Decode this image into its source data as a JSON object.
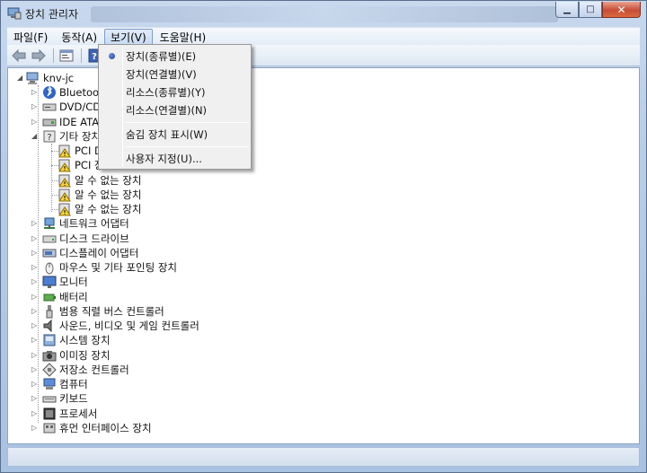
{
  "window": {
    "title": "장치 관리자",
    "controls": {
      "minimize": "▁",
      "maximize": "□",
      "close": "✕"
    }
  },
  "menubar": {
    "items": [
      {
        "label": "파일(F)",
        "active": false
      },
      {
        "label": "동작(A)",
        "active": false
      },
      {
        "label": "보기(V)",
        "active": true
      },
      {
        "label": "도움말(H)",
        "active": false
      }
    ]
  },
  "toolbar": {
    "buttons": [
      "back-arrow-icon",
      "forward-arrow-icon",
      "properties-icon",
      "help-icon"
    ]
  },
  "view_menu": {
    "items": [
      {
        "label": "장치(종류별)(E)",
        "checked": true
      },
      {
        "label": "장치(연결별)(V)",
        "checked": false
      },
      {
        "label": "리소스(종류별)(Y)",
        "checked": false
      },
      {
        "label": "리소스(연결별)(N)",
        "checked": false
      },
      {
        "label": "숨김 장치 표시(W)",
        "checked": false
      },
      {
        "label": "사용자 지정(U)...",
        "checked": false
      }
    ]
  },
  "tree": {
    "root": "knv-jc",
    "nodes": [
      {
        "label": "Bluetooth",
        "icon": "bluetooth-icon",
        "level": 1,
        "expander": "collapsed"
      },
      {
        "label": "DVD/CD",
        "icon": "dvd-drive-icon",
        "level": 1,
        "expander": "collapsed"
      },
      {
        "label": "IDE ATA/",
        "icon": "ide-controller-icon",
        "level": 1,
        "expander": "collapsed"
      },
      {
        "label": "기타 장치",
        "icon": "unknown-device-icon",
        "level": 1,
        "expander": "expanded"
      },
      {
        "label": "PCI D",
        "icon": "warning-device-icon",
        "level": 2
      },
      {
        "label": "PCI 장",
        "icon": "warning-device-icon",
        "level": 2
      },
      {
        "label": "알 수 없는 장치",
        "icon": "warning-device-icon",
        "level": 2
      },
      {
        "label": "알 수 없는 장치",
        "icon": "warning-device-icon",
        "level": 2
      },
      {
        "label": "알 수 없는 장치",
        "icon": "warning-device-icon",
        "level": 2
      },
      {
        "label": "네트워크 어댑터",
        "icon": "network-adapter-icon",
        "level": 1,
        "expander": "collapsed"
      },
      {
        "label": "디스크 드라이브",
        "icon": "disk-drive-icon",
        "level": 1,
        "expander": "collapsed"
      },
      {
        "label": "디스플레이 어댑터",
        "icon": "display-adapter-icon",
        "level": 1,
        "expander": "collapsed"
      },
      {
        "label": "마우스 및 기타 포인팅 장치",
        "icon": "mouse-icon",
        "level": 1,
        "expander": "collapsed"
      },
      {
        "label": "모니터",
        "icon": "monitor-icon",
        "level": 1,
        "expander": "collapsed"
      },
      {
        "label": "배터리",
        "icon": "battery-icon",
        "level": 1,
        "expander": "collapsed"
      },
      {
        "label": "범용 직렬 버스 컨트롤러",
        "icon": "usb-icon",
        "level": 1,
        "expander": "collapsed"
      },
      {
        "label": "사운드, 비디오 및 게임 컨트롤러",
        "icon": "speaker-icon",
        "level": 1,
        "expander": "collapsed"
      },
      {
        "label": "시스템 장치",
        "icon": "system-device-icon",
        "level": 1,
        "expander": "collapsed"
      },
      {
        "label": "이미징 장치",
        "icon": "imaging-device-icon",
        "level": 1,
        "expander": "collapsed"
      },
      {
        "label": "저장소 컨트롤러",
        "icon": "storage-controller-icon",
        "level": 1,
        "expander": "collapsed"
      },
      {
        "label": "컴퓨터",
        "icon": "computer-icon",
        "level": 1,
        "expander": "collapsed"
      },
      {
        "label": "키보드",
        "icon": "keyboard-icon",
        "level": 1,
        "expander": "collapsed"
      },
      {
        "label": "프로세서",
        "icon": "processor-icon",
        "level": 1,
        "expander": "collapsed"
      },
      {
        "label": "휴먼 인터페이스 장치",
        "icon": "hid-icon",
        "level": 1,
        "expander": "collapsed"
      }
    ]
  }
}
